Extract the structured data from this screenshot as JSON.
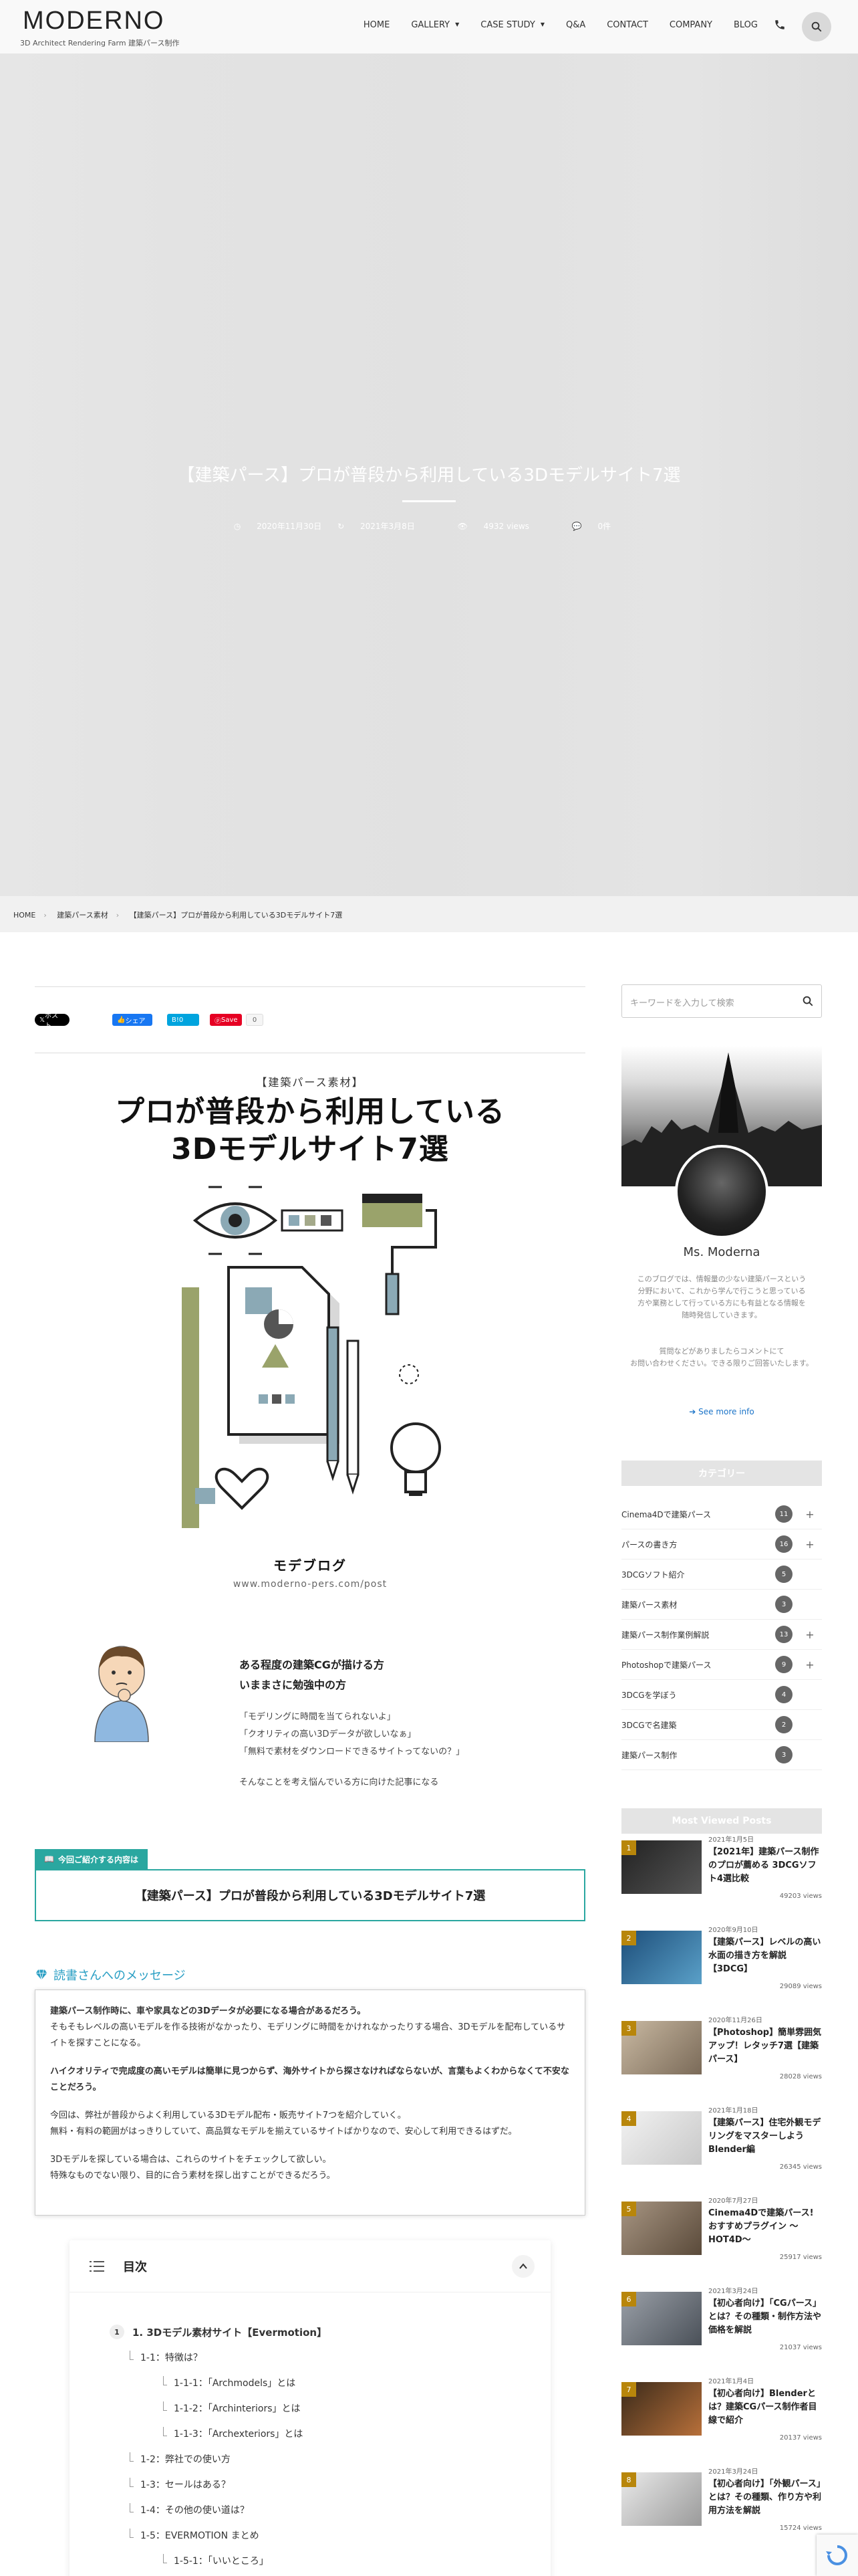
{
  "header": {
    "logo": "MODERNO",
    "logo_sub": "3D Architect Rendering Farm 建築パース制作",
    "nav": [
      "HOME",
      "GALLERY",
      "CASE STUDY",
      "Q&A",
      "CONTACT",
      "COMPANY",
      "BLOG"
    ],
    "phone_icon": "phone-icon",
    "search_icon": "search-icon"
  },
  "hero": {
    "title": "【建築パース】プロが普段から利用している3Dモデルサイト7選",
    "published": "2020年11月30日",
    "updated": "2021年3月8日",
    "views": "4932 views",
    "comments": "0件"
  },
  "breadcrumb": [
    "HOME",
    "建築パース素材",
    "【建築パース】プロが普段から利用している3Dモデルサイト7選"
  ],
  "share": {
    "twitter": "ポスト",
    "facebook": "シェア",
    "hatena": "0",
    "pinterest": "Save",
    "pinterest_count": "0"
  },
  "eyecatch": {
    "tag": "【建築パース素材】",
    "title_line1": "プロが普段から利用している",
    "title_line2": "3Dモデルサイト7選",
    "brand": "モデブログ",
    "url": "www.moderno-pers.com/post",
    "heading_line1": "ある程度の建築CGが描ける方",
    "heading_line2": "いままさに勉強中の方",
    "quote1": "「モデリングに時間を当てられないよ」",
    "quote2": "「クオリティの高い3Dデータが欲しいなぁ」",
    "quote3": "「無料で素材をダウンロードできるサイトってないの？」",
    "closing": "そんなことを考え悩んでいる方に向けた記事になる"
  },
  "intro": {
    "label": "今回ご紹介する内容は",
    "text": "【建築パース】プロが普段から利用している3Dモデルサイト7選"
  },
  "message": {
    "heading": "読書さんへのメッセージ",
    "p1a": "建築パース制作時に、車や家具などの3Dデータが必要になる場合があるだろう。",
    "p1b": "そもそもレベルの高いモデルを作る技術がなかったり、モデリングに時間をかけれなかったりする場合、3Dモデルを配布しているサイトを探すことになる。",
    "p2": "ハイクオリティで完成度の高いモデルは簡単に見つからず、海外サイトから探さなければならないが、言葉もよくわからなくて不安なことだろう。",
    "p3a": "今回は、弊社が普段からよく利用している3Dモデル配布・販売サイト7つを紹介していく。",
    "p3b": "無料・有料の範囲がはっきりしていて、高品質なモデルを揃えているサイトばかりなので、安心して利用できるはずだ。",
    "p4a": "3Dモデルを探している場合は、これらのサイトをチェックして欲しい。",
    "p4b": "特殊なものでない限り、目的に合う素材を探し出すことができるだろう。"
  },
  "toc": {
    "title": "目次",
    "items": [
      {
        "num": "1",
        "text": "1. 3Dモデル素材サイト【Evermotion】"
      },
      {
        "text": "1-1：特徴は？"
      },
      {
        "text": "1-1-1：「Archmodels」とは"
      },
      {
        "text": "1-1-2：「Archinteriors」とは"
      },
      {
        "text": "1-1-3：「Archexteriors」とは"
      },
      {
        "text": "1-2：弊社での使い方"
      },
      {
        "text": "1-3：セールはある？"
      },
      {
        "text": "1-4：その他の使い道は？"
      },
      {
        "text": "1-5：EVERMOTION まとめ"
      },
      {
        "text": "1-5-1：「いいところ」"
      }
    ]
  },
  "sidebar": {
    "search_placeholder": "キーワードを入力して検索",
    "profile_name": "Ms. Moderna",
    "profile_desc1": "このブログでは、情報量の少ない建築パースという",
    "profile_desc2": "分野において、これから学んで行こうと思っている",
    "profile_desc3": "方や業務として行っている方にも有益となる情報を",
    "profile_desc4": "随時発信していきます。",
    "profile_desc5": "質問などがありましたらコメントにて",
    "profile_desc6": "お問い合わせください。できる限りご回答いたします。",
    "see_more": "See more info",
    "category_title": "カテゴリー",
    "categories": [
      {
        "name": "Cinema4Dで建築パース",
        "count": "11",
        "plus": true
      },
      {
        "name": "パースの書き方",
        "count": "16",
        "plus": true
      },
      {
        "name": "3DCGソフト紹介",
        "count": "5",
        "plus": false
      },
      {
        "name": "建築パース素材",
        "count": "3",
        "plus": false
      },
      {
        "name": "建築パース制作業例解説",
        "count": "13",
        "plus": true
      },
      {
        "name": "Photoshopで建築パース",
        "count": "9",
        "plus": true
      },
      {
        "name": "3DCGを学ぼう",
        "count": "4",
        "plus": false
      },
      {
        "name": "3DCGで名建築",
        "count": "2",
        "plus": false
      },
      {
        "name": "建築パース制作",
        "count": "3",
        "plus": false
      }
    ],
    "popular_title": "Most Viewed Posts",
    "posts": [
      {
        "rank": "1",
        "date": "2021年1月5日",
        "title": "【2021年】建築パース制作のプロが薦める 3DCGソフト4選比較",
        "views": "49203 views"
      },
      {
        "rank": "2",
        "date": "2020年9月10日",
        "title": "【建築パース】レベルの高い水面の描き方を解説【3DCG】",
        "views": "29089 views"
      },
      {
        "rank": "3",
        "date": "2020年11月26日",
        "title": "【Photoshop】簡単雰囲気アップ！レタッチ7選【建築パース】",
        "views": "28028 views"
      },
      {
        "rank": "4",
        "date": "2021年1月18日",
        "title": "【建築パース】住宅外観モデリングをマスターしよう Blender編",
        "views": "26345 views"
      },
      {
        "rank": "5",
        "date": "2020年7月27日",
        "title": "Cinema4Dで建築パース! おすすめプラグイン 〜HOT4D〜",
        "views": "25917 views"
      },
      {
        "rank": "6",
        "date": "2021年3月24日",
        "title": "【初心者向け】「CGパース」とは？その種類・制作方法や価格を解説",
        "views": "21037 views"
      },
      {
        "rank": "7",
        "date": "2021年1月4日",
        "title": "【初心者向け】Blenderとは？建築CGパース制作者目線で紹介",
        "views": "20137 views"
      },
      {
        "rank": "8",
        "date": "2021年3月24日",
        "title": "【初心者向け】「外観パース」とは？その種類、作り方や利用方法を解説",
        "views": "15724 views"
      }
    ]
  },
  "colors": {
    "accent_teal": "#2aa7a0",
    "accent_blue": "#2a9fc4",
    "rank_gold": "#b8860b"
  }
}
